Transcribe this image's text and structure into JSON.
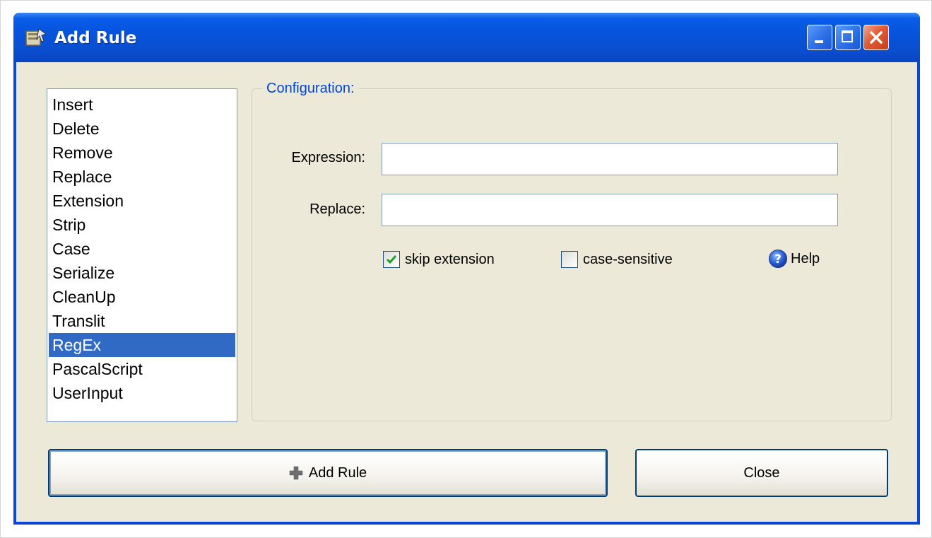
{
  "window": {
    "title": "Add Rule",
    "icons": {
      "app": "rule-app-icon",
      "minimize": "minimize-icon",
      "maximize": "maximize-icon",
      "close": "close-icon"
    }
  },
  "rules": {
    "items": [
      "Insert",
      "Delete",
      "Remove",
      "Replace",
      "Extension",
      "Strip",
      "Case",
      "Serialize",
      "CleanUp",
      "Translit",
      "RegEx",
      "PascalScript",
      "UserInput"
    ],
    "selected": "RegEx"
  },
  "config": {
    "legend": "Configuration:",
    "expression_label": "Expression:",
    "expression_value": "",
    "replace_label": "Replace:",
    "replace_value": "",
    "skip_extension_label": "skip extension",
    "skip_extension_checked": true,
    "case_sensitive_label": "case-sensitive",
    "case_sensitive_checked": false,
    "help_label": "Help"
  },
  "buttons": {
    "add_rule_label": "Add Rule",
    "close_label": "Close"
  },
  "colors": {
    "title_bar": "#0653dc",
    "selection": "#316ac5",
    "legend_text": "#0046d5",
    "dialog_bg": "#ece9d8"
  }
}
